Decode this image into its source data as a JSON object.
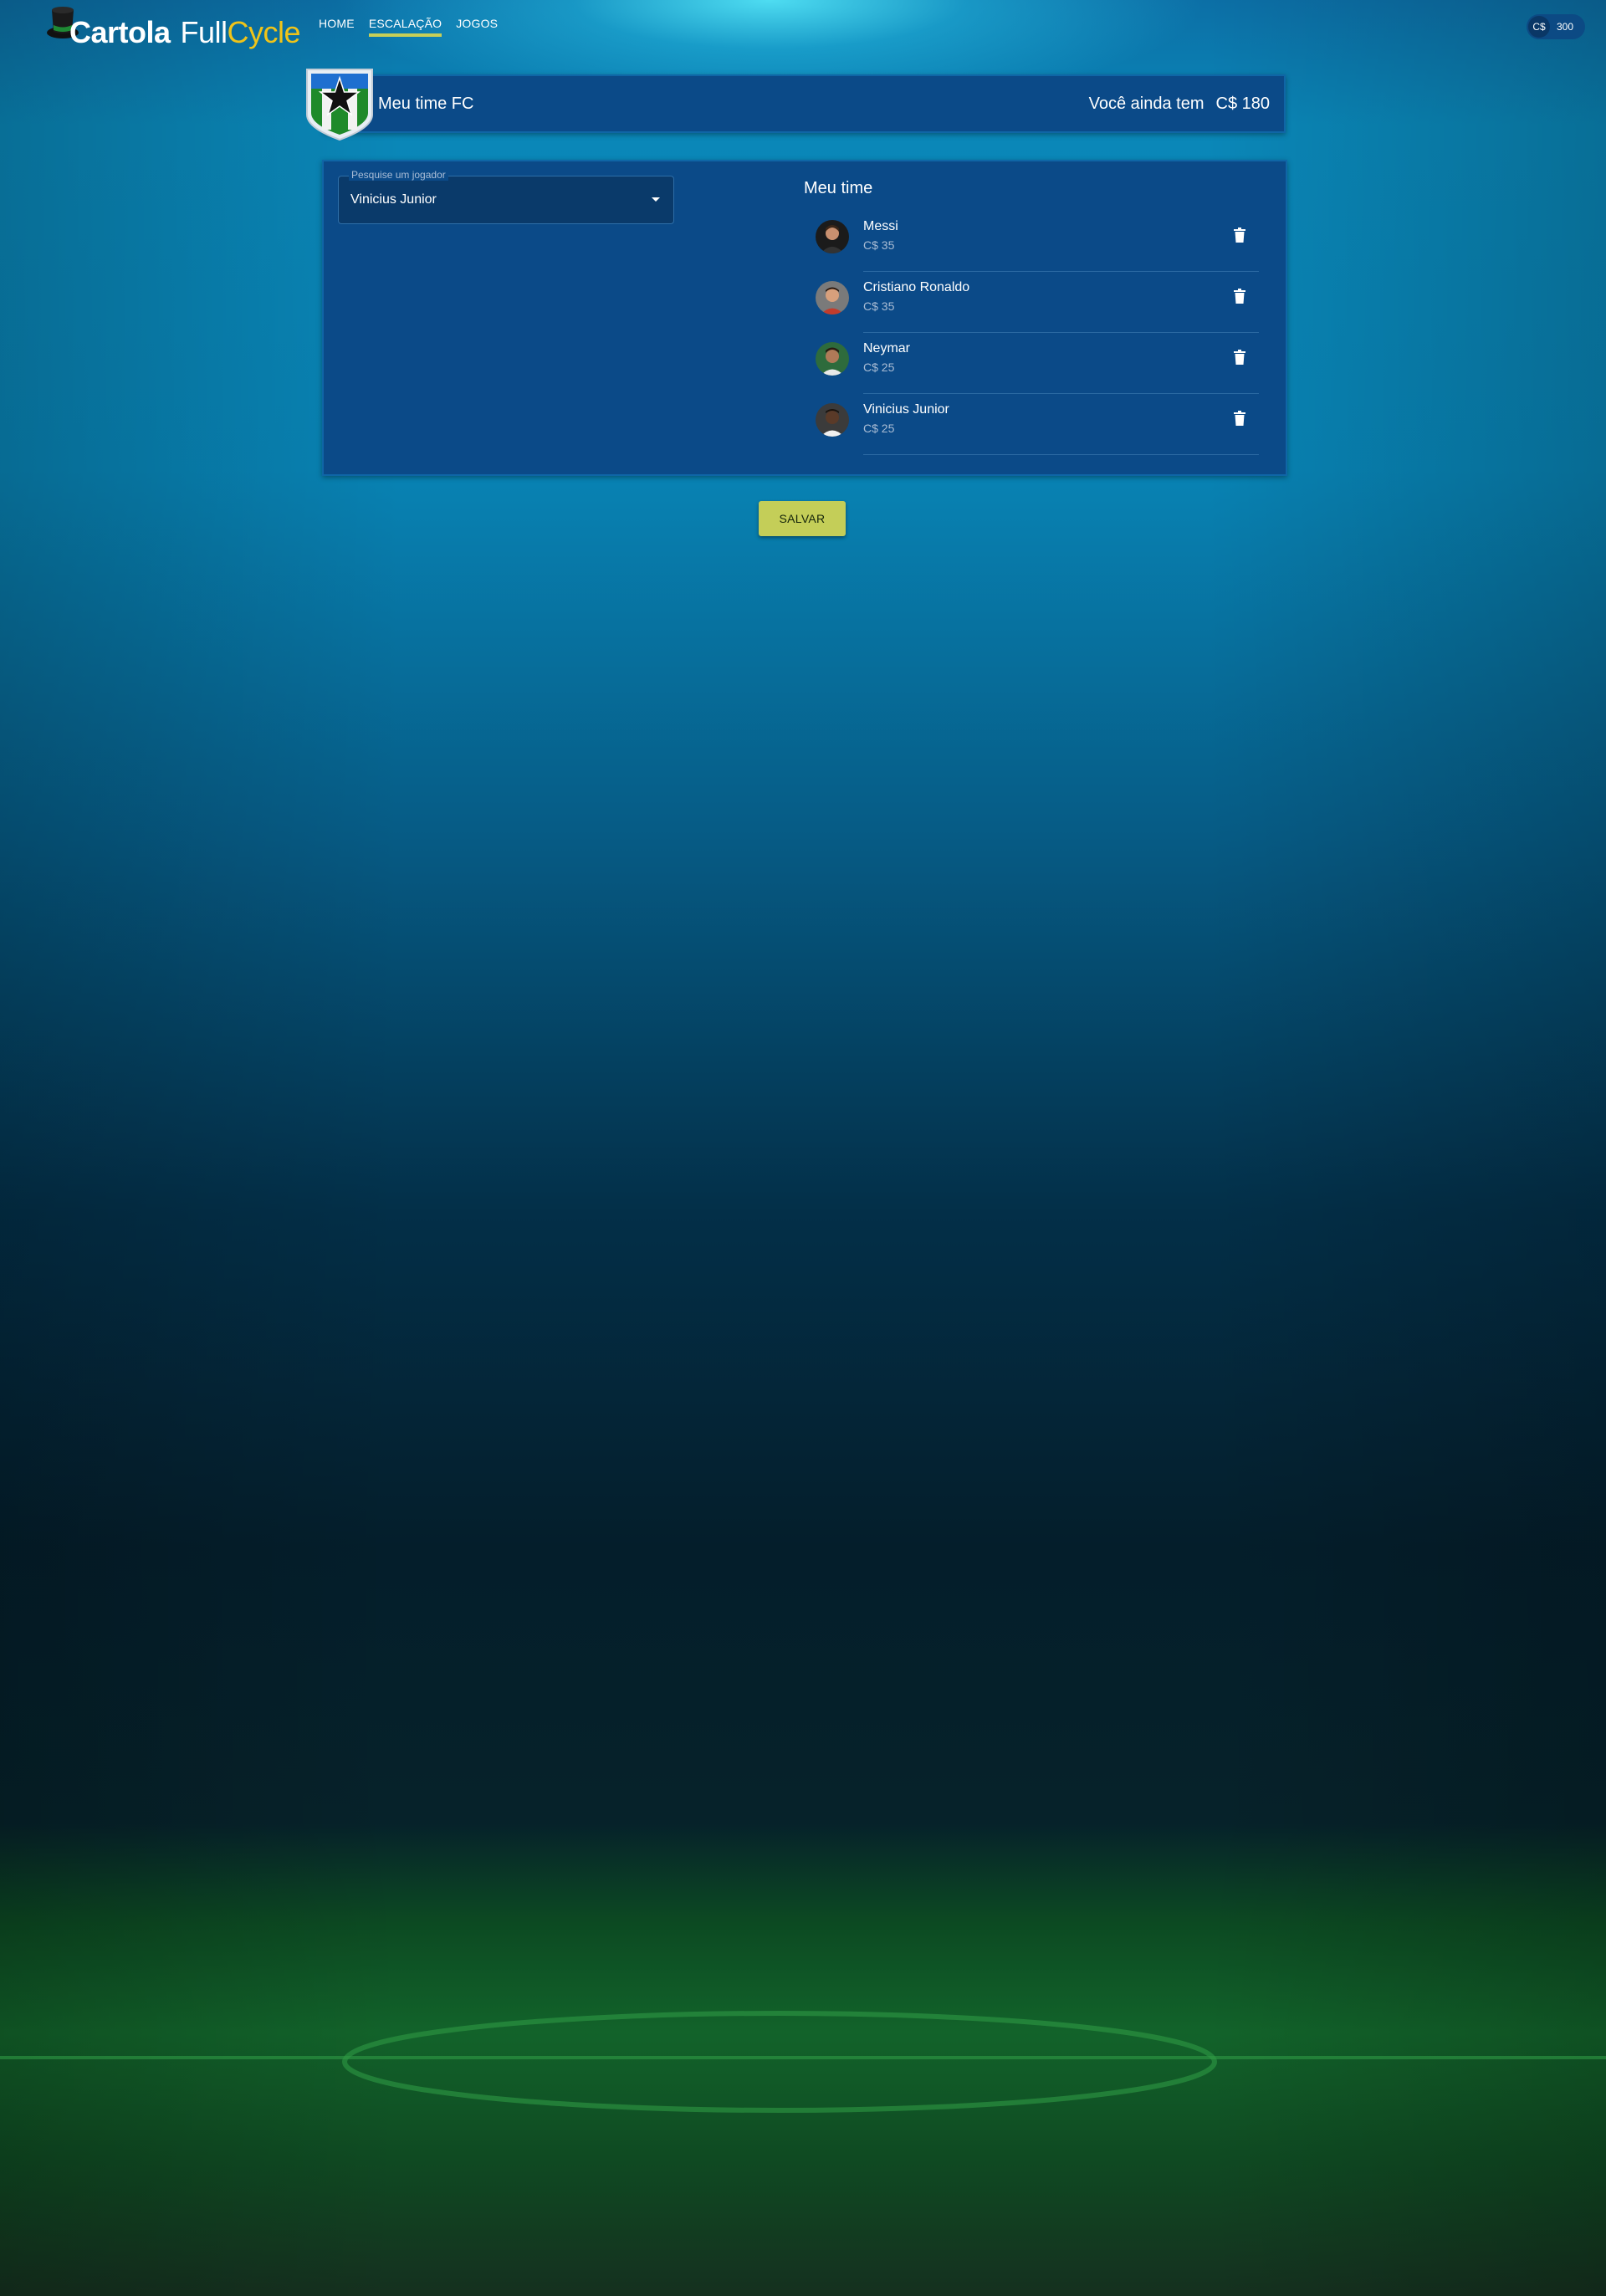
{
  "app": {
    "logo": {
      "part1": "Cartola",
      "part2": "Full",
      "part3": "Cycle"
    },
    "nav": [
      {
        "label": "HOME",
        "active": false
      },
      {
        "label": "ESCALAÇÃO",
        "active": true
      },
      {
        "label": "JOGOS",
        "active": false
      }
    ],
    "balance": {
      "currency": "C$",
      "value": "300"
    }
  },
  "team_header": {
    "name": "Meu time FC",
    "budget_label": "Você ainda tem",
    "budget_value": "C$ 180"
  },
  "search": {
    "label": "Pesquise um jogador",
    "value": "Vinicius Junior"
  },
  "my_team": {
    "title": "Meu time",
    "players": [
      {
        "name": "Messi",
        "price": "C$ 35",
        "icon": "delete-icon"
      },
      {
        "name": "Cristiano Ronaldo",
        "price": "C$ 35",
        "icon": "delete-icon"
      },
      {
        "name": "Neymar",
        "price": "C$ 25",
        "icon": "delete-icon"
      },
      {
        "name": "Vinicius Junior",
        "price": "C$ 25",
        "icon": "delete-icon"
      }
    ]
  },
  "actions": {
    "save_label": "SALVAR"
  },
  "colors": {
    "accent": "#c4ce58",
    "panel": "#0b4a88",
    "logo_yellow": "#f0c419"
  }
}
